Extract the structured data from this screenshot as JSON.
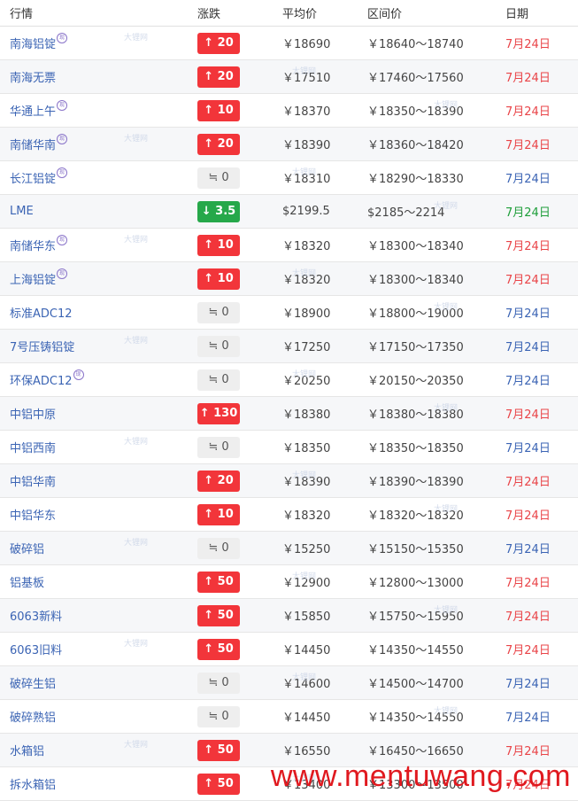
{
  "header": {
    "market": "行情",
    "change": "涨跌",
    "avg": "平均价",
    "range": "区间价",
    "date": "日期"
  },
  "badge_text": "现",
  "watermark_text": "大锂网",
  "footer_watermark": "www.mentuwang.com",
  "colors": {
    "up": "#f2353a",
    "down": "#26a84a",
    "flat": "#eeeeee",
    "link": "#3b64b4",
    "date_red": "#e94448"
  },
  "rows": [
    {
      "name": "南海铝锭",
      "badge": true,
      "dir": "up",
      "change": "↑ 20",
      "avg": "￥18690",
      "range": "￥18640～18740",
      "date": "7月24日",
      "date_color": "red"
    },
    {
      "name": "南海无票",
      "badge": false,
      "dir": "up",
      "change": "↑ 20",
      "avg": "￥17510",
      "range": "￥17460～17560",
      "date": "7月24日",
      "date_color": "red"
    },
    {
      "name": "华通上午",
      "badge": true,
      "dir": "up",
      "change": "↑ 10",
      "avg": "￥18370",
      "range": "￥18350～18390",
      "date": "7月24日",
      "date_color": "red"
    },
    {
      "name": "南储华南",
      "badge": true,
      "dir": "up",
      "change": "↑ 20",
      "avg": "￥18390",
      "range": "￥18360～18420",
      "date": "7月24日",
      "date_color": "red"
    },
    {
      "name": "长江铝锭",
      "badge": true,
      "dir": "flat",
      "change": "≒ 0",
      "avg": "￥18310",
      "range": "￥18290～18330",
      "date": "7月24日",
      "date_color": "blue"
    },
    {
      "name": "LME",
      "badge": false,
      "dir": "down",
      "change": "↓ 3.5",
      "avg": "$2199.5",
      "range": "$2185～2214",
      "date": "7月24日",
      "date_color": "green"
    },
    {
      "name": "南储华东",
      "badge": true,
      "dir": "up",
      "change": "↑ 10",
      "avg": "￥18320",
      "range": "￥18300～18340",
      "date": "7月24日",
      "date_color": "red"
    },
    {
      "name": "上海铝锭",
      "badge": true,
      "dir": "up",
      "change": "↑ 10",
      "avg": "￥18320",
      "range": "￥18300～18340",
      "date": "7月24日",
      "date_color": "red"
    },
    {
      "name": "标准ADC12",
      "badge": false,
      "dir": "flat",
      "change": "≒ 0",
      "avg": "￥18900",
      "range": "￥18800～19000",
      "date": "7月24日",
      "date_color": "blue"
    },
    {
      "name": "7号压铸铝锭",
      "badge": false,
      "dir": "flat",
      "change": "≒ 0",
      "avg": "￥17250",
      "range": "￥17150～17350",
      "date": "7月24日",
      "date_color": "blue"
    },
    {
      "name": "环保ADC12",
      "badge": true,
      "dir": "flat",
      "change": "≒ 0",
      "avg": "￥20250",
      "range": "￥20150～20350",
      "date": "7月24日",
      "date_color": "blue"
    },
    {
      "name": "中铝中原",
      "badge": false,
      "dir": "up",
      "change": "↑ 130",
      "avg": "￥18380",
      "range": "￥18380～18380",
      "date": "7月24日",
      "date_color": "red"
    },
    {
      "name": "中铝西南",
      "badge": false,
      "dir": "flat",
      "change": "≒ 0",
      "avg": "￥18350",
      "range": "￥18350～18350",
      "date": "7月24日",
      "date_color": "blue"
    },
    {
      "name": "中铝华南",
      "badge": false,
      "dir": "up",
      "change": "↑ 20",
      "avg": "￥18390",
      "range": "￥18390～18390",
      "date": "7月24日",
      "date_color": "red"
    },
    {
      "name": "中铝华东",
      "badge": false,
      "dir": "up",
      "change": "↑ 10",
      "avg": "￥18320",
      "range": "￥18320～18320",
      "date": "7月24日",
      "date_color": "red"
    },
    {
      "name": "破碎铝",
      "badge": false,
      "dir": "flat",
      "change": "≒ 0",
      "avg": "￥15250",
      "range": "￥15150～15350",
      "date": "7月24日",
      "date_color": "blue"
    },
    {
      "name": "铝基板",
      "badge": false,
      "dir": "up",
      "change": "↑ 50",
      "avg": "￥12900",
      "range": "￥12800～13000",
      "date": "7月24日",
      "date_color": "red"
    },
    {
      "name": "6063新料",
      "badge": false,
      "dir": "up",
      "change": "↑ 50",
      "avg": "￥15850",
      "range": "￥15750～15950",
      "date": "7月24日",
      "date_color": "red"
    },
    {
      "name": "6063旧料",
      "badge": false,
      "dir": "up",
      "change": "↑ 50",
      "avg": "￥14450",
      "range": "￥14350～14550",
      "date": "7月24日",
      "date_color": "red"
    },
    {
      "name": "破碎生铝",
      "badge": false,
      "dir": "flat",
      "change": "≒ 0",
      "avg": "￥14600",
      "range": "￥14500～14700",
      "date": "7月24日",
      "date_color": "blue"
    },
    {
      "name": "破碎熟铝",
      "badge": false,
      "dir": "flat",
      "change": "≒ 0",
      "avg": "￥14450",
      "range": "￥14350～14550",
      "date": "7月24日",
      "date_color": "blue"
    },
    {
      "name": "水箱铝",
      "badge": false,
      "dir": "up",
      "change": "↑ 50",
      "avg": "￥16550",
      "range": "￥16450～16650",
      "date": "7月24日",
      "date_color": "red"
    },
    {
      "name": "拆水箱铝",
      "badge": false,
      "dir": "up",
      "change": "↑ 50",
      "avg": "￥13400",
      "range": "￥13300～13500",
      "date": "7月24日",
      "date_color": "red"
    }
  ]
}
